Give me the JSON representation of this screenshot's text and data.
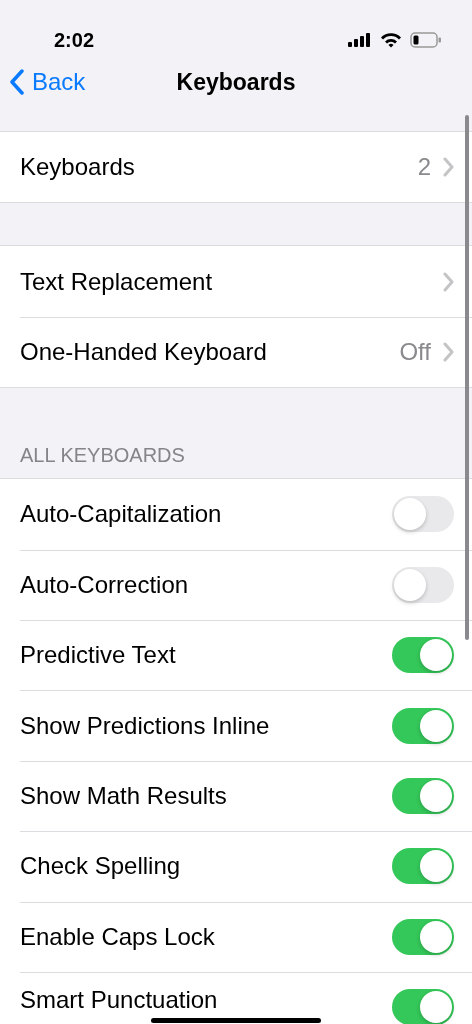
{
  "status_bar": {
    "time": "2:02"
  },
  "nav": {
    "back": "Back",
    "title": "Keyboards"
  },
  "groups": [
    {
      "rows": [
        {
          "kind": "link",
          "label": "Keyboards",
          "value": "2"
        }
      ]
    },
    {
      "rows": [
        {
          "kind": "link",
          "label": "Text Replacement"
        },
        {
          "kind": "link",
          "label": "One-Handed Keyboard",
          "value": "Off"
        }
      ]
    },
    {
      "header": "ALL KEYBOARDS",
      "rows": [
        {
          "kind": "toggle",
          "label": "Auto-Capitalization",
          "on": false
        },
        {
          "kind": "toggle",
          "label": "Auto-Correction",
          "on": false
        },
        {
          "kind": "toggle",
          "label": "Predictive Text",
          "on": true
        },
        {
          "kind": "toggle",
          "label": "Show Predictions Inline",
          "on": true
        },
        {
          "kind": "toggle",
          "label": "Show Math Results",
          "on": true
        },
        {
          "kind": "toggle",
          "label": "Check Spelling",
          "on": true
        },
        {
          "kind": "toggle",
          "label": "Enable Caps Lock",
          "on": true
        },
        {
          "kind": "toggle",
          "label": "Smart Punctuation",
          "on": true
        }
      ]
    }
  ]
}
